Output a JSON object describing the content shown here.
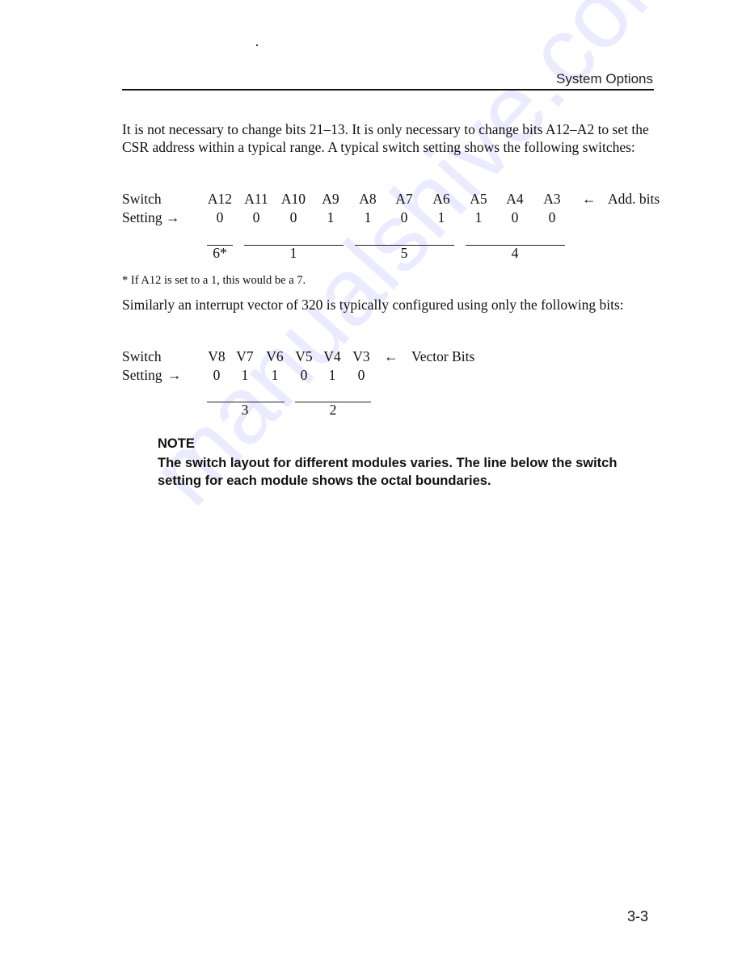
{
  "header": {
    "running_title": "System Options"
  },
  "body": {
    "paragraph_1": "It is not necessary to change bits 21–13. It is only necessary to change bits A12–A2 to set the CSR address within a typical range. A typical switch setting shows the following switches:",
    "address_table": {
      "row_labels": [
        "Switch",
        "Setting →"
      ],
      "bits": [
        "A12",
        "A11",
        "A10",
        "A9",
        "A8",
        "A7",
        "A6",
        "A5",
        "A4",
        "A3"
      ],
      "settings": [
        "0",
        "0",
        "0",
        "1",
        "1",
        "0",
        "1",
        "1",
        "0",
        "0"
      ],
      "bits_arrow": "←",
      "bits_caption": "Add. bits",
      "octal_groups": [
        "6*",
        "1",
        "5",
        "4"
      ]
    },
    "footnote": "* If A12 is set to a 1, this would be a 7.",
    "paragraph_2": "Similarly an interrupt vector of 320 is typically configured using only the following bits:",
    "vector_table": {
      "row_labels": [
        "Switch",
        "Setting"
      ],
      "setting_arrow": "→",
      "bits": [
        "V8",
        "V7",
        "V6",
        "V5",
        "V4",
        "V3"
      ],
      "settings": [
        "0",
        "1",
        "1",
        "0",
        "1",
        "0"
      ],
      "bits_arrow": "←",
      "bits_caption": "Vector Bits",
      "octal_groups": [
        "3",
        "2"
      ]
    },
    "note": {
      "title": "NOTE",
      "text": "The switch layout for different modules varies. The line below the switch setting for each module shows the octal boundaries."
    }
  },
  "footer": {
    "page_number": "3-3"
  },
  "watermark": "manualshive.com"
}
